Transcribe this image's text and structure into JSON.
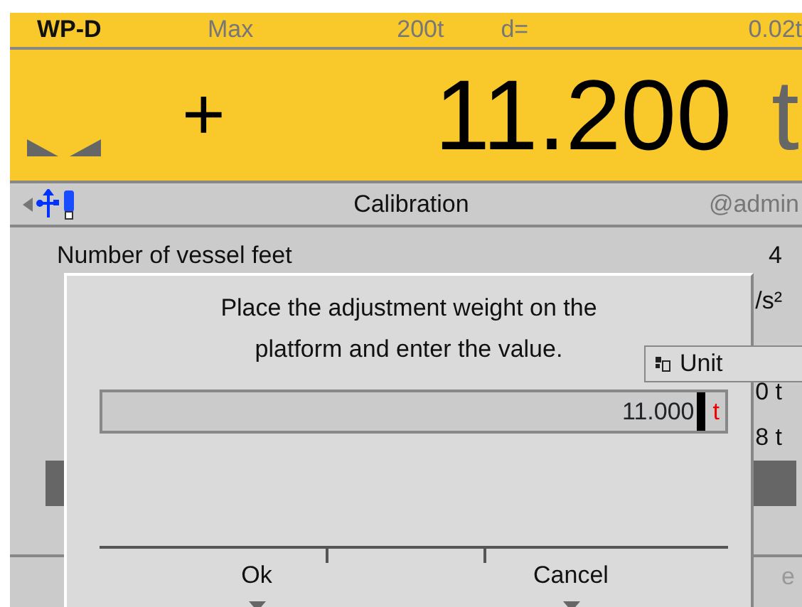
{
  "header": {
    "device": "WP-D",
    "max_label": "Max",
    "max_value": "200t",
    "d_label": "d=",
    "d_value": "0.02t"
  },
  "display": {
    "sign": "+",
    "value": "11.200",
    "unit": "t"
  },
  "title_bar": {
    "title": "Calibration",
    "user": "@admin"
  },
  "list": [
    {
      "label": "Number of vessel feet",
      "value": "4",
      "selected": false
    },
    {
      "value": "/s²",
      "selected": false
    },
    {
      "selected": false
    },
    {
      "value": "0 t",
      "selected": false
    },
    {
      "value": "8 t",
      "selected": false
    },
    {
      "selected": true
    },
    {
      "selected": false
    }
  ],
  "footer": {
    "right": "e"
  },
  "dialog": {
    "message": "Place the adjustment weight on the platform and enter the value.",
    "input": {
      "value": "11.000",
      "unit": "t"
    },
    "buttons": [
      "Ok",
      "Cancel"
    ]
  },
  "popup": {
    "label": "Unit"
  }
}
